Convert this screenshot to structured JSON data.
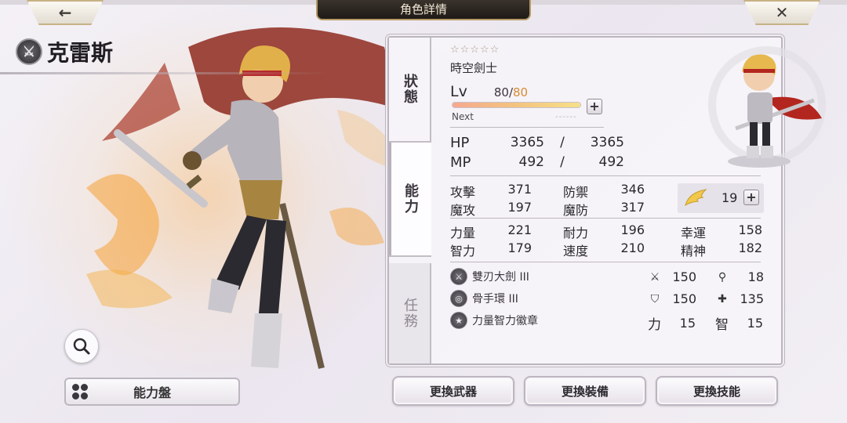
{
  "header": {
    "title": "角色詳情",
    "back_icon": "arrow-left-icon",
    "close_icon": "close-icon",
    "back_glyph": "←",
    "close_glyph": "✕"
  },
  "character": {
    "name": "克雷斯",
    "weapon_type_icon": "sword-icon"
  },
  "side_tabs": [
    {
      "label": "狀態"
    },
    {
      "label": "能力"
    },
    {
      "label": "任務"
    }
  ],
  "status": {
    "stars": "☆☆☆☆☆",
    "job": "時空劍士",
    "lv_label": "Lv",
    "lv_current": "80",
    "lv_sep": "/",
    "lv_max": "80",
    "exp_fill_percent": 100,
    "next_label": "Next",
    "next_value": "------",
    "hp_label": "HP",
    "hp_cur": "3365",
    "hp_sep": "/",
    "hp_max": "3365",
    "mp_label": "MP",
    "mp_cur": "492",
    "mp_sep": "/",
    "mp_max": "492"
  },
  "stats": {
    "atk": {
      "k": "攻擊",
      "v": "371"
    },
    "def": {
      "k": "防禦",
      "v": "346"
    },
    "mag": {
      "k": "魔攻",
      "v": "197"
    },
    "mdef": {
      "k": "魔防",
      "v": "317"
    },
    "str": {
      "k": "力量",
      "v": "221"
    },
    "vit": {
      "k": "耐力",
      "v": "196"
    },
    "luck": {
      "k": "幸運",
      "v": "158"
    },
    "int": {
      "k": "智力",
      "v": "179"
    },
    "spd": {
      "k": "速度",
      "v": "210"
    },
    "spi": {
      "k": "精神",
      "v": "182"
    },
    "wing_value": "19"
  },
  "equipment": [
    {
      "name": "雙刃大劍 III",
      "icon": "sword-icon"
    },
    {
      "name": "骨手環 III",
      "icon": "bracelet-icon"
    },
    {
      "name": "力量智力徽章",
      "icon": "badge-icon"
    }
  ],
  "equip_stats": {
    "atk": "150",
    "mag": "18",
    "def": "150",
    "mdef": "135",
    "str_label": "力",
    "str": "15",
    "int_label": "智",
    "int": "15"
  },
  "buttons": {
    "board": "能力盤",
    "change_weapon": "更換武器",
    "change_equip": "更換裝備",
    "change_skill": "更換技能"
  },
  "colors": {
    "accent_gold": "#c7b285",
    "lv_max": "#d78b34",
    "header_bg": "#2a241f"
  }
}
